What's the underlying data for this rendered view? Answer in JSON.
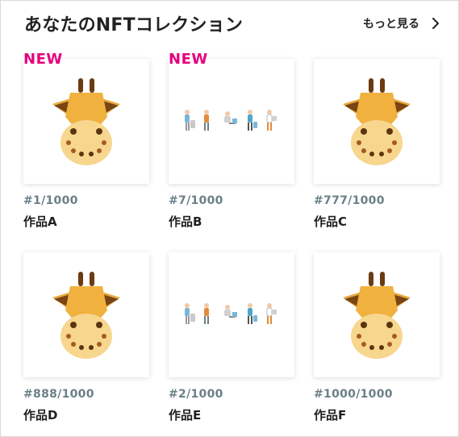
{
  "header": {
    "title": "あなたのNFTコレクション",
    "more_label": "もっと見る",
    "more_icon": "chevron-right-icon"
  },
  "badge_label": "NEW",
  "colors": {
    "badge": "#e6007e",
    "edition_text": "#6b7f87"
  },
  "items": [
    {
      "edition": "#1/1000",
      "name": "作品A",
      "is_new": true,
      "artwork": "giraffe-icon"
    },
    {
      "edition": "#7/1000",
      "name": "作品B",
      "is_new": true,
      "artwork": "people-illustration"
    },
    {
      "edition": "#777/1000",
      "name": "作品C",
      "is_new": false,
      "artwork": "giraffe-icon"
    },
    {
      "edition": "#888/1000",
      "name": "作品D",
      "is_new": false,
      "artwork": "giraffe-icon"
    },
    {
      "edition": "#2/1000",
      "name": "作品E",
      "is_new": false,
      "artwork": "people-illustration"
    },
    {
      "edition": "#1000/1000",
      "name": "作品F",
      "is_new": false,
      "artwork": "giraffe-icon"
    }
  ]
}
